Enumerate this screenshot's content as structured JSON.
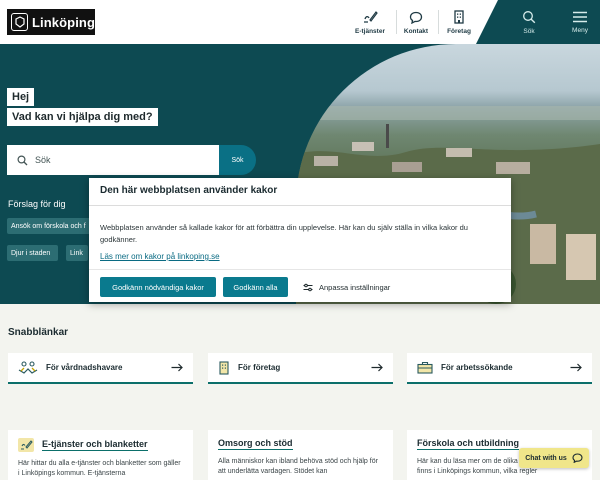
{
  "header": {
    "logo_text": "Linköping",
    "nav": [
      {
        "label": "E-tjänster",
        "icon": "pen-form-icon"
      },
      {
        "label": "Kontakt",
        "icon": "speech-bubble-icon"
      },
      {
        "label": "Företag",
        "icon": "building-icon"
      }
    ],
    "search_label": "Sök",
    "menu_label": "Meny"
  },
  "hero": {
    "greeting_1": "Hej",
    "greeting_2": "Vad kan vi hjälpa dig med?",
    "search_placeholder": "Sök",
    "search_button": "Sök",
    "suggestions_title": "Förslag för dig",
    "chips": [
      "Ansök om förskola och f",
      "Djur i staden",
      "Link"
    ]
  },
  "cookie_modal": {
    "title": "Den här webbplatsen använder kakor",
    "body": "Webbplatsen använder så kallade kakor för att förbättra din upplevelse. Här kan du själv ställa in vilka kakor du godkänner.",
    "link": "Läs mer om kakor på linkoping.se",
    "btn_necessary": "Godkänn nödvändiga kakor",
    "btn_all": "Godkänn alla",
    "btn_customize": "Anpassa inställningar"
  },
  "quick_links": {
    "title": "Snabblänkar",
    "items": [
      {
        "label": "För vårdnadshavare",
        "icon": "family-icon"
      },
      {
        "label": "För företag",
        "icon": "office-icon"
      },
      {
        "label": "För arbetssökande",
        "icon": "briefcase-icon"
      }
    ]
  },
  "cards": [
    {
      "title": "E-tjänster och blanketter",
      "text": "Här hittar du alla e-tjänster och blanketter som gäller i Linköpings kommun. E-tjänsterna"
    },
    {
      "title": "Omsorg och stöd",
      "text": "Alla människor kan ibland behöva stöd och hjälp för att underlätta vardagen. Stödet kan"
    },
    {
      "title": "Förskola och utbildning",
      "text": "Här kan du läsa mer om de olika skolformer som finns i Linköpings kommun, vilka regler"
    }
  ],
  "chat_label": "Chat with us",
  "colors": {
    "teal_dark": "#0d4a52",
    "teal_button": "#0a7a8e",
    "accent": "#0b6f6a",
    "chat": "#f0e68a"
  }
}
